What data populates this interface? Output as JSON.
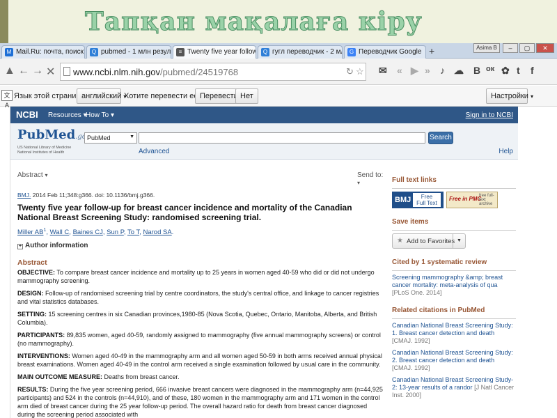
{
  "slide": {
    "title": "Тапқан мақалаға кіру"
  },
  "browser": {
    "tabs": [
      {
        "icon_text": "M",
        "icon_color": "#1d6fd6",
        "label": "Mail.Ru: почта, поиск в инт"
      },
      {
        "icon_text": "Q",
        "icon_color": "#2e7fd8",
        "label": "pubmed - 1 млн результат"
      },
      {
        "icon_text": "≡",
        "icon_color": "#555555",
        "label": "Twenty five year follow-up f"
      },
      {
        "icon_text": "Q",
        "icon_color": "#2e7fd8",
        "label": "гугл переводчик - 2 млн ре"
      },
      {
        "icon_text": "G",
        "icon_color": "#3b82f6",
        "label": "Переводчик Google"
      }
    ],
    "new_tab": "+",
    "window_buttons": {
      "user": "Asima B",
      "min": "–",
      "max": "▢",
      "close": "✕"
    },
    "url_domain": "www.ncbi.nlm.nih.gov",
    "url_path": "/pubmed/24519768",
    "toolbar_icons": [
      "✉",
      "«",
      "▶",
      "»",
      "♪",
      "☁",
      "В",
      "ок",
      "✿",
      "t",
      "f"
    ]
  },
  "translate_bar": {
    "prompt": "Язык этой страницы:",
    "language": "английский",
    "question": "Хотите перевести ее?",
    "translate_button": "Перевести",
    "no_button": "Нет",
    "settings_button": "Настройки"
  },
  "ncbi": {
    "logo": "NCBI",
    "resources": "Resources",
    "howto": "How To",
    "signin": "Sign in to NCBI"
  },
  "pubmed": {
    "logo_main": "PubMed",
    "logo_gov": ".gov",
    "sub1": "US National Library of Medicine",
    "sub2": "National Institutes of Health",
    "db_select": "PubMed",
    "search_button": "Search",
    "advanced": "Advanced",
    "help": "Help"
  },
  "article": {
    "abstract_dropdown": "Abstract",
    "send_to": "Send to:",
    "journal": "BMJ.",
    "citation_rest": " 2014 Feb 11;348:g366. doi: 10.1136/bmj.g366.",
    "title": "Twenty five year follow-up for breast cancer incidence and mortality of the Canadian National Breast Screening Study: randomised screening trial.",
    "authors": [
      "Miller AB",
      "Wall C",
      "Baines CJ",
      "Sun P",
      "To T",
      "Narod SA"
    ],
    "author_sup": "1",
    "author_info": "Author information",
    "abstract_heading": "Abstract",
    "sections": [
      {
        "label": "OBJECTIVE:",
        "text": " To compare breast cancer incidence and mortality up to 25 years in women aged 40-59 who did or did not undergo mammography screening."
      },
      {
        "label": "DESIGN:",
        "text": " Follow-up of randomised screening trial by centre coordinators, the study's central office, and linkage to cancer registries and vital statistics databases."
      },
      {
        "label": "SETTING:",
        "text": " 15 screening centres in six Canadian provinces,1980-85 (Nova Scotia, Quebec, Ontario, Manitoba, Alberta, and British Columbia)."
      },
      {
        "label": "PARTICIPANTS:",
        "text": " 89,835 women, aged 40-59, randomly assigned to mammography (five annual mammography screens) or control (no mammography)."
      },
      {
        "label": "INTERVENTIONS:",
        "text": " Women aged 40-49 in the mammography arm and all women aged 50-59 in both arms received annual physical breast examinations. Women aged 40-49 in the control arm received a single examination followed by usual care in the community."
      },
      {
        "label": "MAIN OUTCOME MEASURE:",
        "text": " Deaths from breast cancer."
      },
      {
        "label": "RESULTS:",
        "text": " During the five year screening period, 666 invasive breast cancers were diagnosed in the mammography arm (n=44,925 participants) and 524 in the controls (n=44,910), and of these, 180 women in the mammography arm and 171 women in the control arm died of breast cancer during the 25 year follow-up period. The overall hazard ratio for death from breast cancer diagnosed during the screening period associated with"
      }
    ]
  },
  "sidebar": {
    "fulltext_heading": "Full text links",
    "bmj_logo": "BMJ",
    "bmj_free1": "Free",
    "bmj_free2": "Full Text",
    "pmc_logo": "Free in PMC",
    "pmc_small": "free full-text archive",
    "save_heading": "Save items",
    "add_favorites": "Add to Favorites",
    "cited_heading": "Cited by 1 systematic review",
    "cited": [
      {
        "text": "Screening mammography &amp; breast cancer mortality: meta-analysis of qua",
        "src": "[PLoS One. 2014]"
      }
    ],
    "related_heading": "Related citations in PubMed",
    "related": [
      {
        "text": "Canadian National Breast Screening Study: 1. Breast cancer detection and death ",
        "src": "[CMAJ. 1992]"
      },
      {
        "text": "Canadian National Breast Screening Study: 2. Breast cancer detection and death ",
        "src": "[CMAJ. 1992]"
      },
      {
        "text": "Canadian National Breast Screening Study-2: 13-year results of a randor ",
        "src": "[J Natl Cancer Inst. 2000]"
      }
    ]
  }
}
